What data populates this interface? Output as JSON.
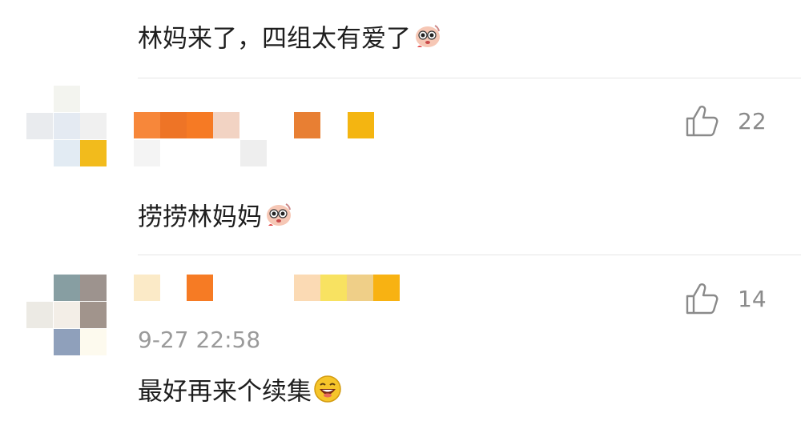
{
  "comments": [
    {
      "text": "林妈来了，四组太有爱了"
    },
    {
      "text": "捞捞林妈妈",
      "likes": "22"
    },
    {
      "text": "最好再来个续集",
      "likes": "14",
      "timestamp": "9-27 22:58"
    }
  ],
  "icons": {
    "like": "thumbs-up-icon",
    "sticker": "cartoon-face-sticker-icon",
    "laugh": "laughing-face-emoji-icon"
  },
  "colors": {
    "divider": "#e6e6e6",
    "like_text": "#8a8a8a",
    "timestamp": "#9a9a9a",
    "orange": "#f5832a",
    "yellow": "#f2b414"
  }
}
